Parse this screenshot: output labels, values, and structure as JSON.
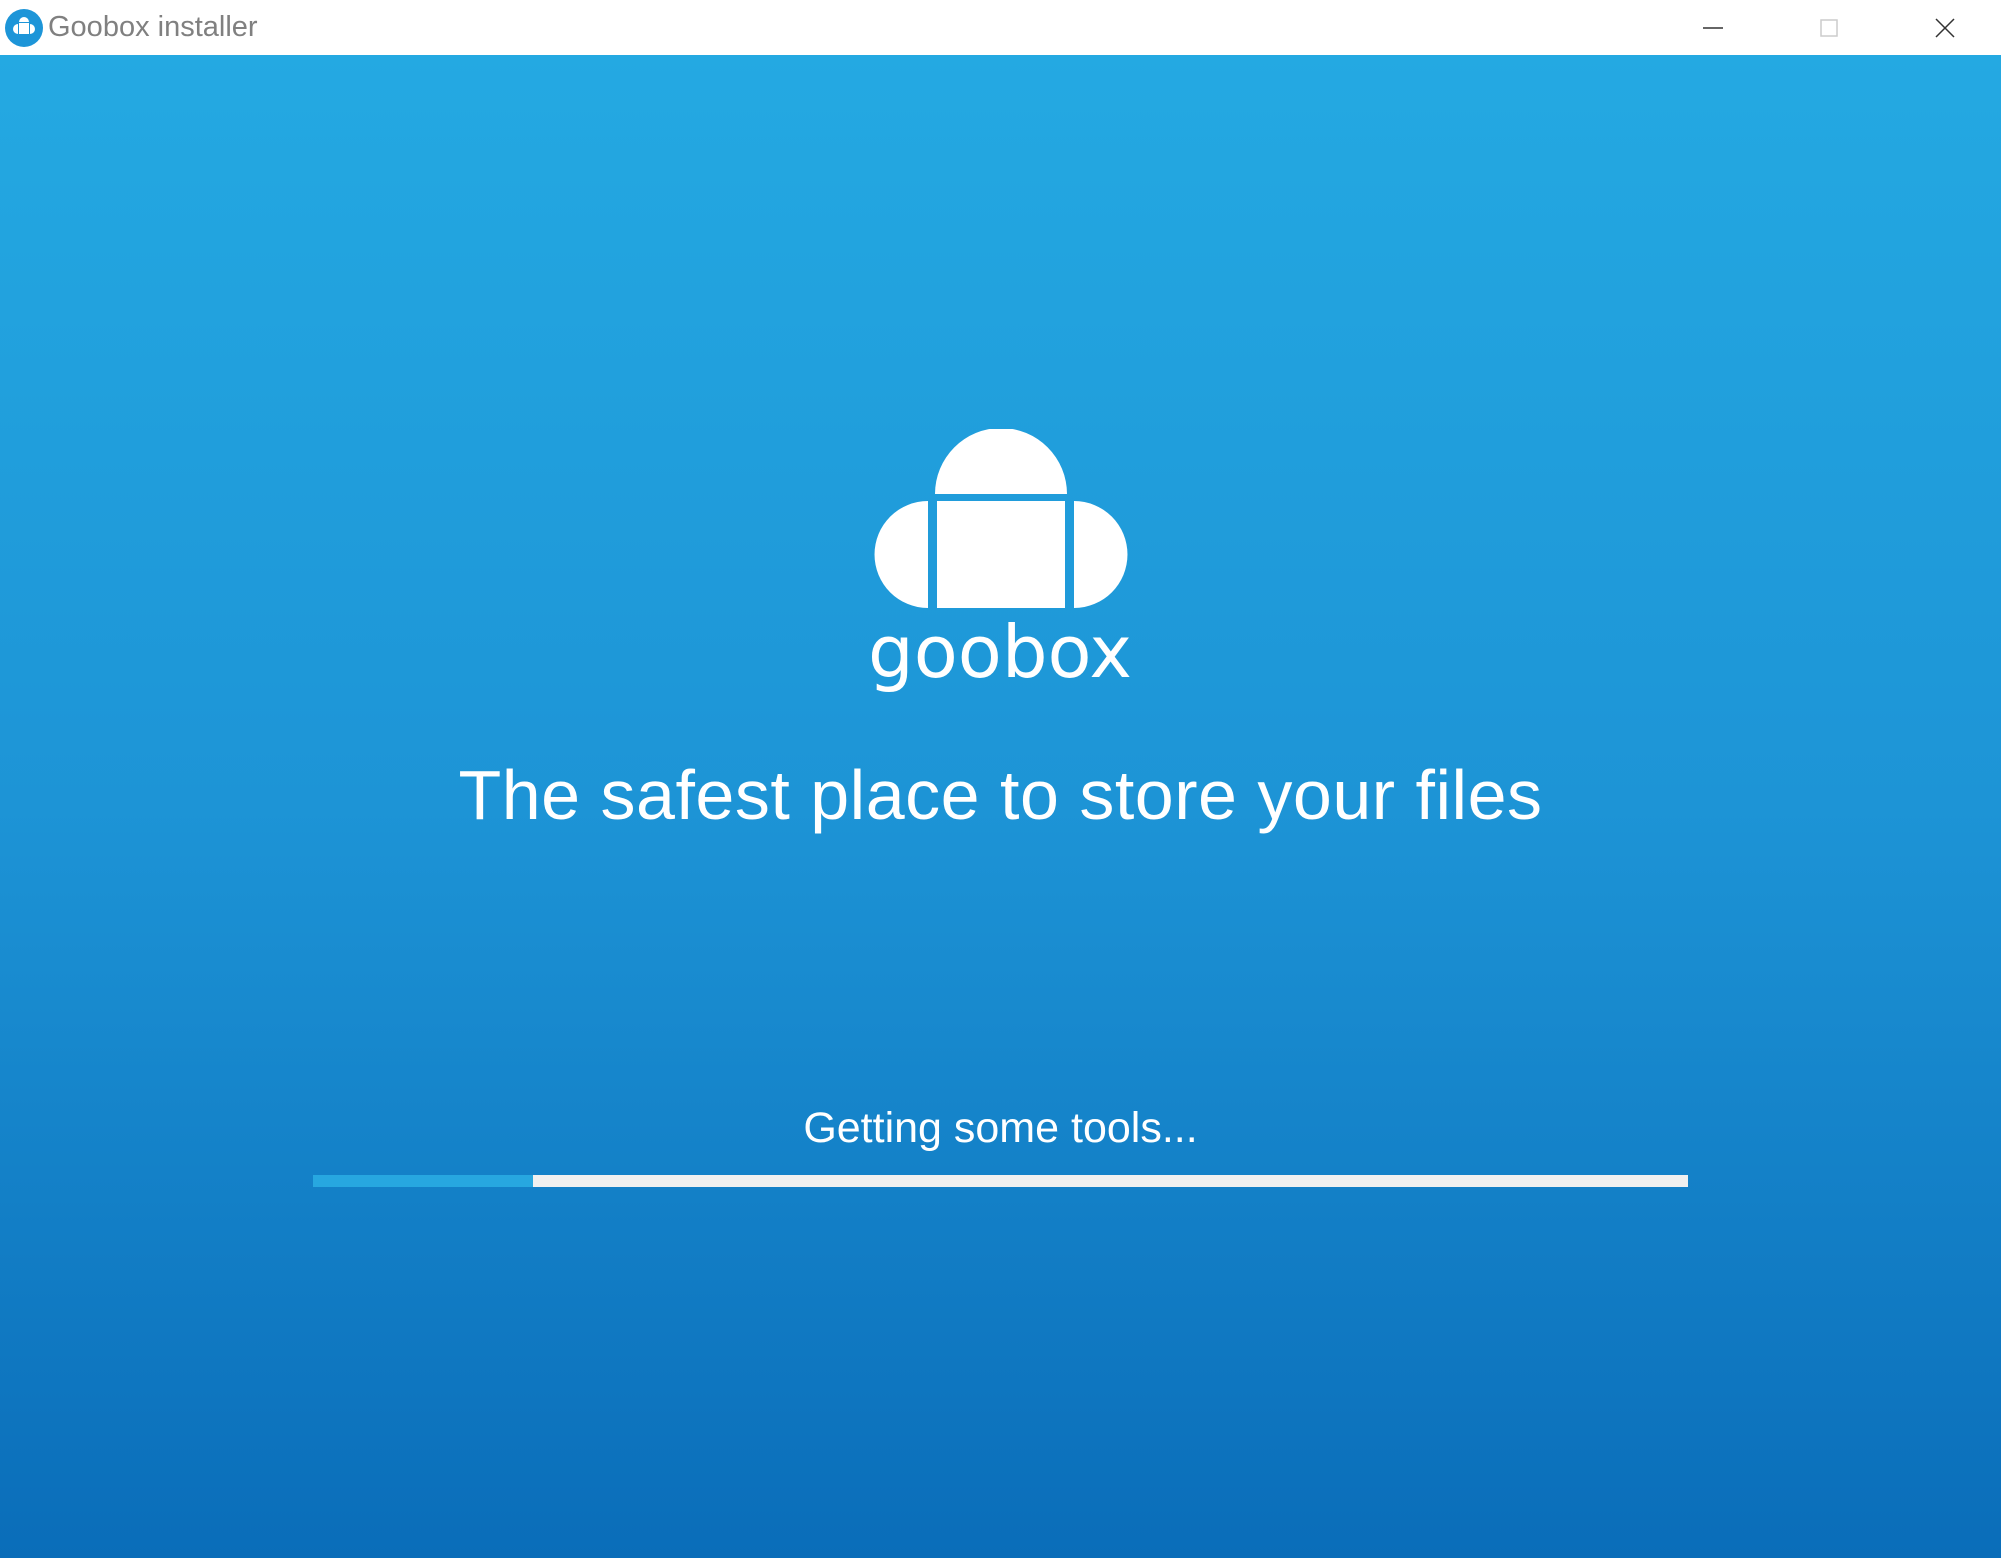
{
  "window": {
    "title": "Goobox installer",
    "controls": {
      "minimize_icon": "minimize-icon",
      "maximize_icon": "maximize-icon",
      "close_icon": "close-icon"
    }
  },
  "main": {
    "logo_text": "goobox",
    "tagline": "The safest place to store your files",
    "status_text": "Getting some tools...",
    "progress_fraction": 0.16
  },
  "colors": {
    "gradient_top": "#24a9e2",
    "gradient_bottom": "#0a6db9",
    "progress_fill": "#27a7e0",
    "progress_track": "#f0f0f0",
    "title_text": "#808080"
  }
}
